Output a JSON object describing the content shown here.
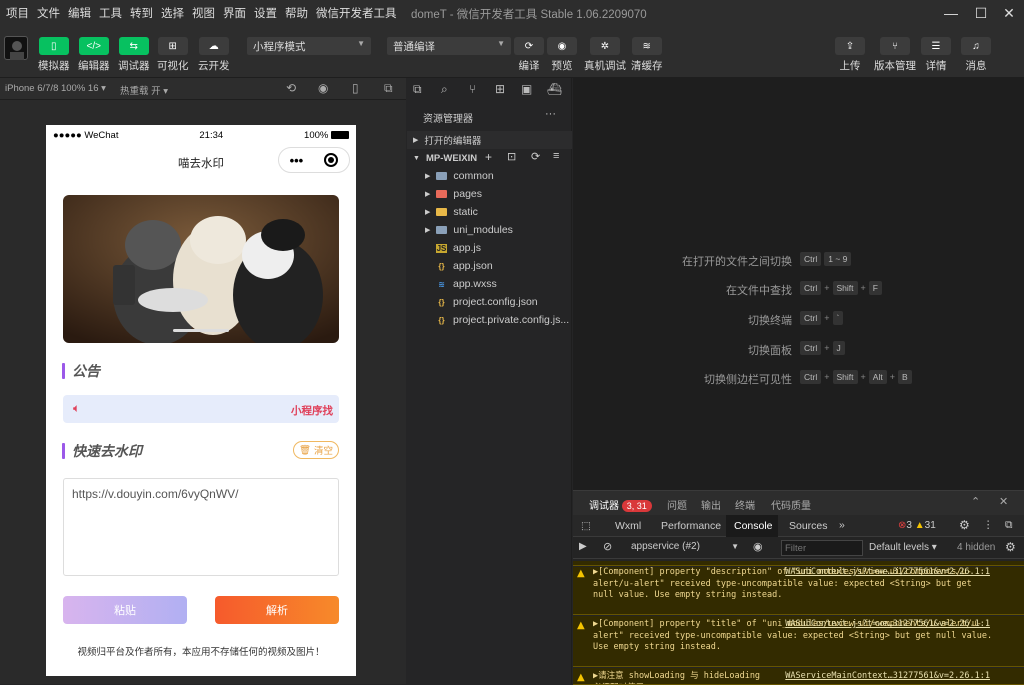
{
  "menubar": {
    "items": [
      "项目",
      "文件",
      "编辑",
      "工具",
      "转到",
      "选择",
      "视图",
      "界面",
      "设置",
      "帮助",
      "微信开发者工具"
    ],
    "title": "domeT - 微信开发者工具 Stable 1.06.2209070"
  },
  "toolbar": {
    "simulator": "模拟器",
    "editor": "编辑器",
    "debugger": "调试器",
    "visual": "可视化",
    "cloud": "云开发",
    "mode_select": "小程序模式",
    "compile_select": "普通编译",
    "compile": "编译",
    "preview": "预览",
    "remote_debug": "真机调试",
    "clear_cache": "清缓存",
    "upload": "上传",
    "version": "版本管理",
    "details": "详情",
    "messages": "消息"
  },
  "subbar": {
    "device": "iPhone 6/7/8 100% 16",
    "hot_reload": "热重载 开"
  },
  "phone": {
    "carrier": "●●●●● WeChat",
    "time": "21:34",
    "battery": "100%",
    "nav_title": "喵去水印",
    "notice_title": "公告",
    "notice_text": "小程序找",
    "section_title": "快速去水印",
    "clear_label": "清空",
    "input_value": "https://v.douyin.com/6vyQnWV/",
    "paste_label": "粘贴",
    "parse_label": "解析",
    "footer": "视频归平台及作者所有，本应用不存储任何的视频及图片！"
  },
  "explorer": {
    "title": "资源管理器",
    "open_editors": "打开的编辑器",
    "project": "MP-WEIXIN",
    "folders": [
      "common",
      "pages",
      "static",
      "uni_modules"
    ],
    "files": [
      "app.js",
      "app.json",
      "app.wxss",
      "project.config.json",
      "project.private.config.js..."
    ]
  },
  "shortcuts": [
    {
      "label": "在打开的文件之间切换",
      "keys": [
        "Ctrl",
        "1 ~ 9"
      ]
    },
    {
      "label": "在文件中查找",
      "keys": [
        "Ctrl",
        "Shift",
        "F"
      ]
    },
    {
      "label": "切换终端",
      "keys": [
        "Ctrl",
        "`"
      ]
    },
    {
      "label": "切换面板",
      "keys": [
        "Ctrl",
        "J"
      ]
    },
    {
      "label": "切换侧边栏可见性",
      "keys": [
        "Ctrl",
        "Shift",
        "Alt",
        "B"
      ]
    }
  ],
  "devtools": {
    "tabs_top": [
      "调试器",
      "问题",
      "输出",
      "终端",
      "代码质量"
    ],
    "badge": "3, 31",
    "tabs": [
      "Wxml",
      "Performance",
      "Console",
      "Sources"
    ],
    "error_count": "3",
    "warn_count": "31",
    "context": "appservice (#2)",
    "filter_placeholder": "Filter",
    "levels": "Default levels",
    "hidden": "4 hidden",
    "logs": [
      {
        "text": "▶[Component] property \"description\" of \"uni_modules/uview-ui/components/u-alert/u-alert\" received type-uncompatible value: expected <String> but get null value. Use empty string instead.",
        "src": "WASubContext.js?t=we…31277561&v=2.26.1:1"
      },
      {
        "text": "▶[Component] property \"title\" of \"uni_modules/uview-ui/components/u-alert/u-alert\" received type-uncompatible value: expected <String> but get null value. Use empty string instead.",
        "src": "WASubContext.js?t=we…31277561&v=2.26.1:1"
      },
      {
        "text": "▶请注意 showLoading 与 hideLoading 必须配对使用",
        "src": "WAServiceMainContext…31277561&v=2.26.1:1"
      }
    ]
  },
  "colors": {
    "accent": "#07c160",
    "parse": "#f65a2c",
    "notice_bg": "#e6ecfb",
    "section_bar": "#9b59e9"
  }
}
